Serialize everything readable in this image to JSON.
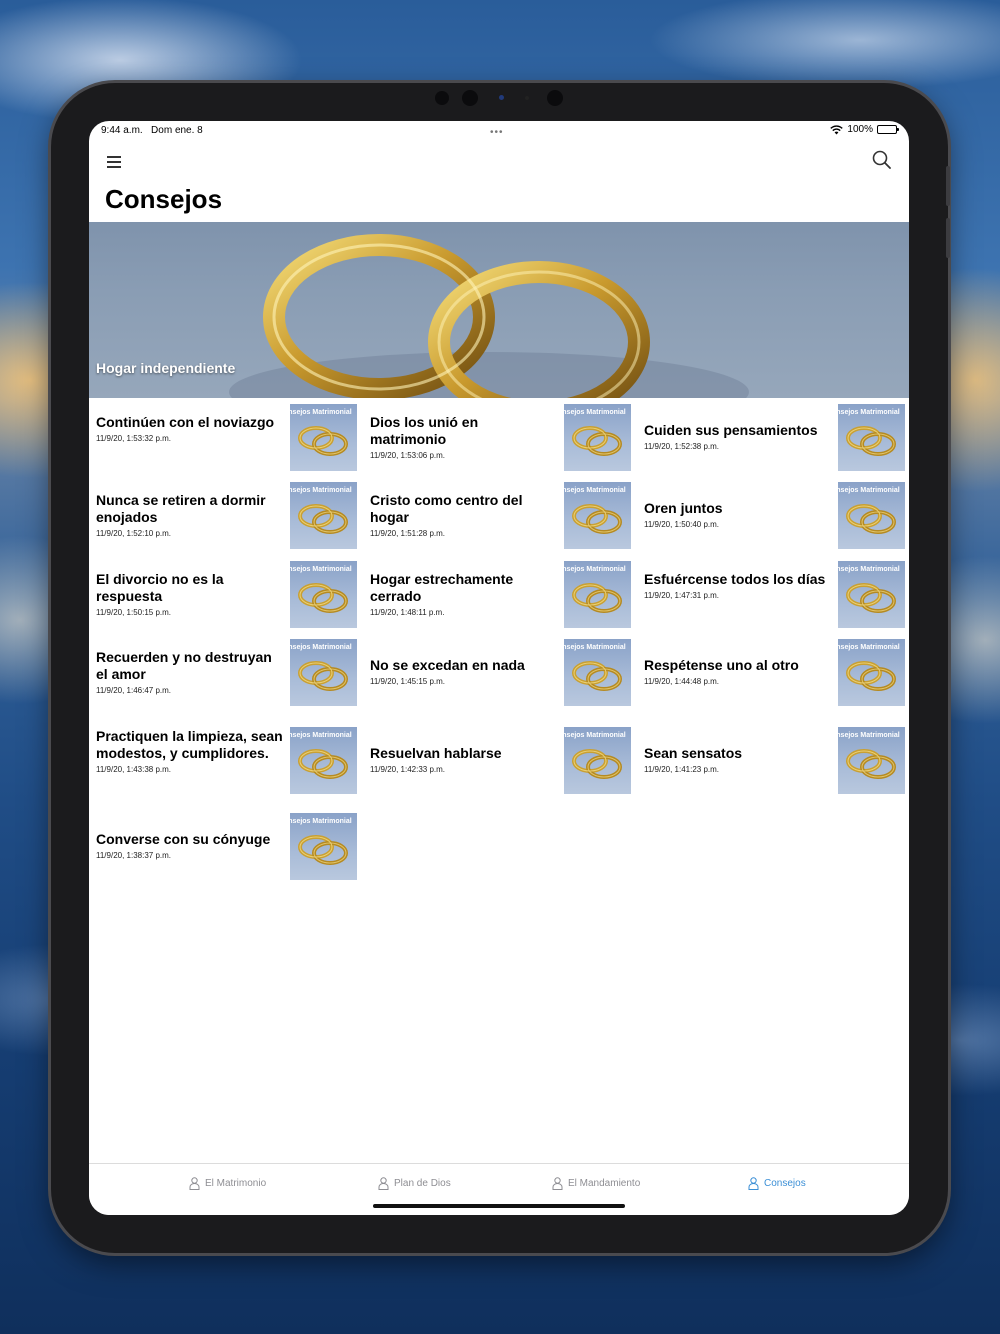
{
  "status_bar": {
    "time": "9:44 a.m.",
    "date": "Dom ene. 8",
    "battery": "100%"
  },
  "header": {
    "title": "Consejos"
  },
  "hero": {
    "label": "Hogar independiente"
  },
  "thumb_caption": "onsejos Matrimonial",
  "articles": [
    {
      "title": "Continúen con el noviazgo",
      "date": "11/9/20, 1:53:32 p.m."
    },
    {
      "title": "Dios los unió en matrimonio",
      "date": "11/9/20, 1:53:06 p.m."
    },
    {
      "title": "Cuiden sus pensamientos",
      "date": "11/9/20, 1:52:38 p.m."
    },
    {
      "title": "Nunca se retiren a dormir enojados",
      "date": "11/9/20, 1:52:10 p.m."
    },
    {
      "title": "Cristo como centro del hogar",
      "date": "11/9/20, 1:51:28 p.m."
    },
    {
      "title": "Oren juntos",
      "date": "11/9/20, 1:50:40 p.m."
    },
    {
      "title": "El divorcio no es la respuesta",
      "date": "11/9/20, 1:50:15 p.m."
    },
    {
      "title": "Hogar estrechamente cerrado",
      "date": "11/9/20, 1:48:11 p.m."
    },
    {
      "title": "Esfuércense todos los días",
      "date": "11/9/20, 1:47:31 p.m."
    },
    {
      "title": "Recuerden y no destruyan el amor",
      "date": "11/9/20, 1:46:47 p.m."
    },
    {
      "title": "No se excedan en nada",
      "date": "11/9/20, 1:45:15 p.m."
    },
    {
      "title": "Respétense uno al otro",
      "date": "11/9/20, 1:44:48 p.m."
    },
    {
      "title": "Practiquen la limpieza, sean modestos, y cumplidores.",
      "date": "11/9/20, 1:43:38 p.m."
    },
    {
      "title": "Resuelvan hablarse",
      "date": "11/9/20, 1:42:33 p.m."
    },
    {
      "title": "Sean sensatos",
      "date": "11/9/20, 1:41:23 p.m."
    },
    {
      "title": "Converse con su cónyuge",
      "date": "11/9/20, 1:38:37 p.m."
    }
  ],
  "tabs": [
    {
      "label": "El Matrimonio",
      "icon": "person-icon",
      "active": false
    },
    {
      "label": "Plan de Dios",
      "icon": "person-icon",
      "active": false
    },
    {
      "label": "El Mandamiento",
      "icon": "person-icon",
      "active": false
    },
    {
      "label": "Consejos",
      "icon": "person-icon",
      "active": true
    }
  ],
  "colors": {
    "accent": "#3b8fd6",
    "tab_inactive": "#8e8e93"
  }
}
